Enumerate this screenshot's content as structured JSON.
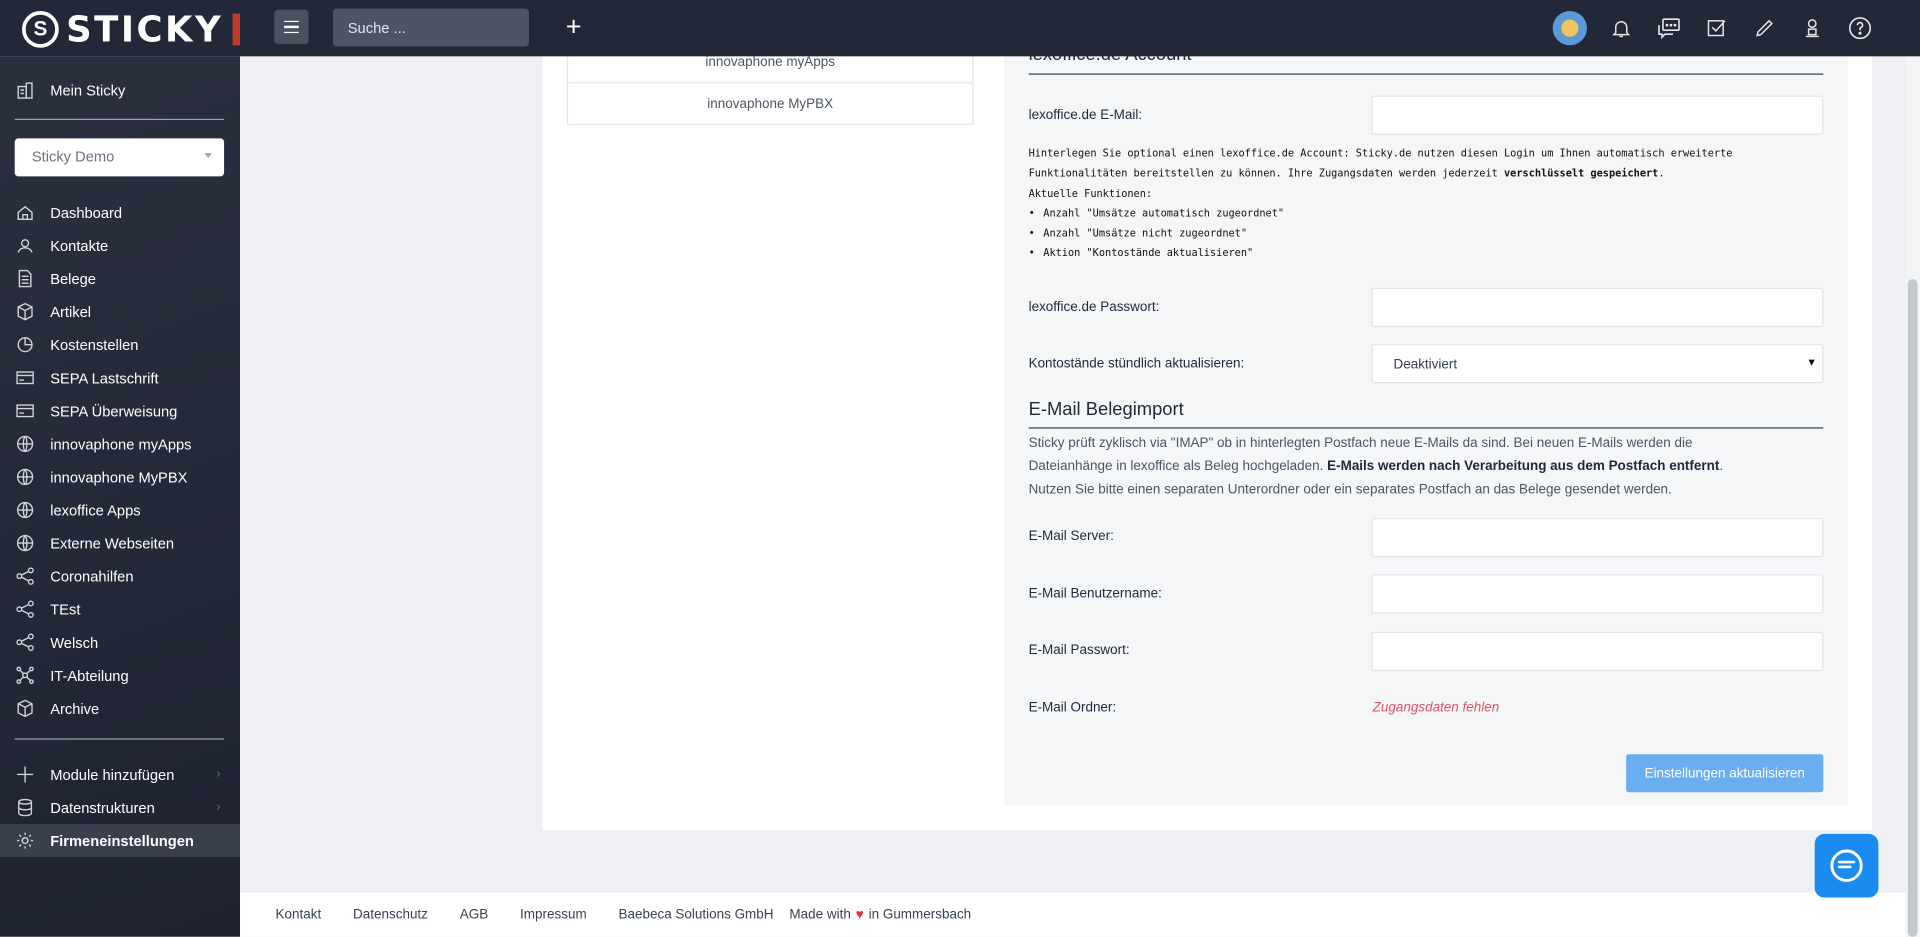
{
  "app": {
    "logo_text": "STICKY",
    "logo_mark": "S"
  },
  "header": {
    "search_placeholder": "Suche ...",
    "plus_label": "+",
    "icons": [
      "avatar",
      "bell-icon",
      "chat-icon",
      "check-square-icon",
      "pencil-icon",
      "user-icon",
      "help-icon"
    ]
  },
  "sidebar": {
    "top_item": "Mein Sticky",
    "company_select": "Sticky Demo",
    "items": [
      {
        "label": "Dashboard",
        "icon": "home-icon"
      },
      {
        "label": "Kontakte",
        "icon": "contacts-icon"
      },
      {
        "label": "Belege",
        "icon": "document-icon"
      },
      {
        "label": "Artikel",
        "icon": "box-icon"
      },
      {
        "label": "Kostenstellen",
        "icon": "pie-icon"
      },
      {
        "label": "SEPA Lastschrift",
        "icon": "card-icon"
      },
      {
        "label": "SEPA Überweisung",
        "icon": "card-icon"
      },
      {
        "label": "innovaphone myApps",
        "icon": "globe-icon"
      },
      {
        "label": "innovaphone MyPBX",
        "icon": "globe-icon"
      },
      {
        "label": "lexoffice Apps",
        "icon": "globe-icon"
      },
      {
        "label": "Externe Webseiten",
        "icon": "globe-icon"
      },
      {
        "label": "Coronahilfen",
        "icon": "share-icon"
      },
      {
        "label": "TEst",
        "icon": "share-icon"
      },
      {
        "label": "Welsch",
        "icon": "share-icon"
      },
      {
        "label": "IT-Abteilung",
        "icon": "network-icon"
      },
      {
        "label": "Archive",
        "icon": "box-icon"
      }
    ],
    "bottom_items": [
      {
        "label": "Module hinzufügen",
        "icon": "plus-icon"
      },
      {
        "label": "Datenstrukturen",
        "icon": "database-icon"
      },
      {
        "label": "Firmeneinstellungen",
        "icon": "gear-icon"
      }
    ]
  },
  "left_list": [
    "innovaphone myApps",
    "innovaphone MyPBX"
  ],
  "lexoffice": {
    "section_title": "lexoffice.de Account",
    "email_label": "lexoffice.de E-Mail:",
    "info_line1": "Hinterlegen Sie optional einen lexoffice.de Account: Sticky.de nutzen diesen Login um Ihnen automatisch erweiterte",
    "info_line2a": "Funktionalitäten bereitstellen zu können. Ihre Zugangsdaten werden jederzeit ",
    "info_line2b": "verschlüsselt gespeichert",
    "info_line2c": ".",
    "info_line3": "Aktuelle Funktionen:",
    "functions": [
      "Anzahl \"Umsätze automatisch zugeordnet\"",
      "Anzahl \"Umsätze nicht zugeordnet\"",
      "Aktion \"Kontostände aktualisieren\""
    ],
    "password_label": "lexoffice.de Passwort:",
    "hourly_label": "Kontostände stündlich aktualisieren:",
    "hourly_value": "Deaktiviert"
  },
  "email_import": {
    "section_title": "E-Mail Belegimport",
    "desc1": "Sticky prüft zyklisch via \"IMAP\" ob in hinterlegten Postfach neue E-Mails da sind. Bei neuen E-Mails werden die",
    "desc2a": "Dateianhänge in lexoffice als Beleg hochgeladen. ",
    "desc2b": "E-Mails werden nach Verarbeitung aus dem Postfach entfernt",
    "desc2c": ".",
    "desc3": "Nutzen Sie bitte einen separaten Unterordner oder ein separates Postfach an das Belege gesendet werden.",
    "server_label": "E-Mail Server:",
    "user_label": "E-Mail Benutzername:",
    "password_label": "E-Mail Passwort:",
    "folder_label": "E-Mail Ordner:",
    "folder_error": "Zugangsdaten fehlen",
    "submit_label": "Einstellungen aktualisieren"
  },
  "footer": {
    "links": [
      "Kontakt",
      "Datenschutz",
      "AGB",
      "Impressum",
      "Baebeca Solutions GmbH"
    ],
    "made_prefix": "Made with",
    "made_suffix": "in Gummersbach"
  },
  "colors": {
    "topbar": "#232838",
    "accent_button": "#6aaef2",
    "chat_button": "#1a8cf0",
    "error": "#e05666",
    "heart": "#e02d3c"
  }
}
